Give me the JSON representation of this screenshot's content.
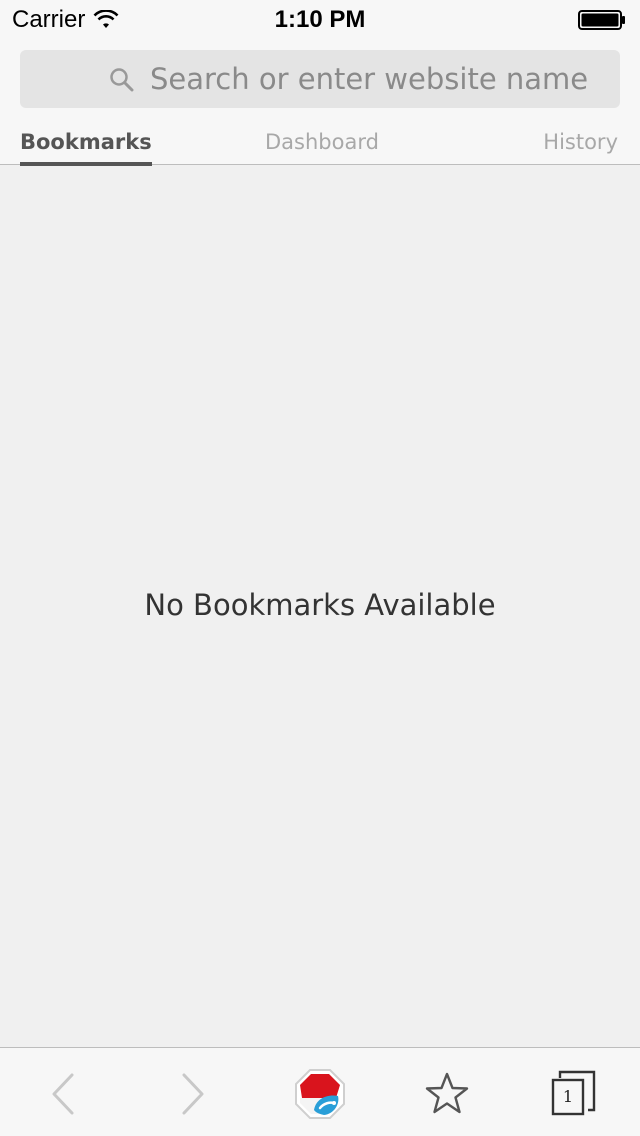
{
  "status_bar": {
    "carrier": "Carrier",
    "time": "1:10 PM"
  },
  "search": {
    "placeholder": "Search or enter website name"
  },
  "tabs": [
    {
      "label": "Bookmarks",
      "active": true
    },
    {
      "label": "Dashboard",
      "active": false
    },
    {
      "label": "History",
      "active": false
    }
  ],
  "empty_state": {
    "message": "No Bookmarks Available"
  },
  "toolbar": {
    "tab_count": "1",
    "icons": [
      "back-chevron-icon",
      "forward-chevron-icon",
      "app-logo-icon",
      "star-icon",
      "tabs-icon"
    ]
  },
  "colors": {
    "background": "#f0f0f0",
    "bar_background": "#f7f7f7",
    "search_background": "#e4e4e4",
    "logo_red": "#d9141d",
    "logo_blue": "#2a9fd8"
  }
}
